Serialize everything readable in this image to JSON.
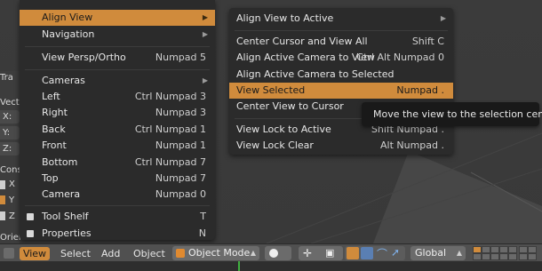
{
  "left_panel": {
    "tab_partial": "Tra",
    "vector_label_partial": "Vecto",
    "xyz_fields": [
      "X:",
      "Y:",
      "Z:"
    ],
    "constraints_partial": "Const",
    "axes": [
      "X",
      "Y",
      "Z"
    ],
    "orientation_partial": "Orien"
  },
  "main_menu": {
    "items": [
      {
        "label": "Align View",
        "shortcut": "",
        "submenu": true
      },
      {
        "label": "Navigation",
        "shortcut": "",
        "submenu": true
      },
      {
        "label": "View Persp/Ortho",
        "shortcut": "Numpad 5"
      },
      {
        "label": "Cameras",
        "shortcut": "",
        "submenu": true
      },
      {
        "label": "Left",
        "shortcut": "Ctrl Numpad 3"
      },
      {
        "label": "Right",
        "shortcut": "Numpad 3"
      },
      {
        "label": "Back",
        "shortcut": "Ctrl Numpad 1"
      },
      {
        "label": "Front",
        "shortcut": "Numpad 1"
      },
      {
        "label": "Bottom",
        "shortcut": "Ctrl Numpad 7"
      },
      {
        "label": "Top",
        "shortcut": "Numpad 7"
      },
      {
        "label": "Camera",
        "shortcut": "Numpad 0"
      },
      {
        "label": "Tool Shelf",
        "shortcut": "T"
      },
      {
        "label": "Properties",
        "shortcut": "N"
      }
    ]
  },
  "sub_menu": {
    "items": [
      {
        "label": "Align View to Active",
        "shortcut": "",
        "submenu": true
      },
      {
        "label": "Center Cursor and View All",
        "shortcut": "Shift C"
      },
      {
        "label": "Align Active Camera to View",
        "shortcut": "Ctrl Alt Numpad 0"
      },
      {
        "label": "Align Active Camera to Selected",
        "shortcut": ""
      },
      {
        "label": "View Selected",
        "shortcut": "Numpad ."
      },
      {
        "label": "Center View to Cursor",
        "shortcut": ""
      },
      {
        "label": "View Lock to Active",
        "shortcut": "Shift Numpad ."
      },
      {
        "label": "View Lock Clear",
        "shortcut": "Alt Numpad ."
      }
    ]
  },
  "tooltip": "Move the view to the selection center",
  "header": {
    "view": "View",
    "select": "Select",
    "add": "Add",
    "object": "Object",
    "mode": "Object Mode",
    "orientation": "Global"
  },
  "colors": {
    "highlight": "#d08b3c",
    "menu_bg": "#2b2b2b",
    "header_bg": "#505050"
  }
}
